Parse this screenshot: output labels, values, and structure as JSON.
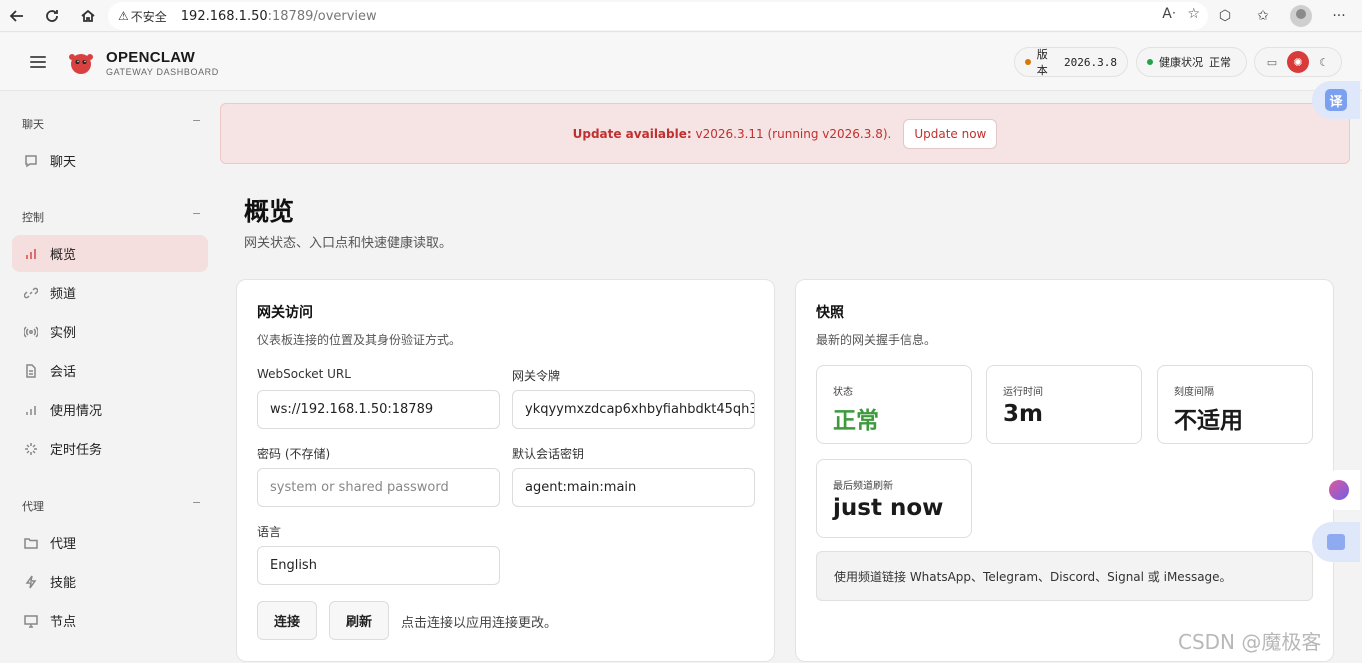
{
  "browser": {
    "insecure_label": "不安全",
    "url_host": "192.168.1.50",
    "url_path": ":18789/overview"
  },
  "header": {
    "brand_title": "OPENCLAW",
    "brand_subtitle": "GATEWAY DASHBOARD",
    "version_label": "版本",
    "version_value": "2026.3.8",
    "health_label": "健康状况",
    "health_value": "正常",
    "version_dot_color": "#d97706",
    "health_dot_color": "#22a34a"
  },
  "sidebar": {
    "sections": [
      {
        "label": "聊天",
        "collapse": "−",
        "items": [
          {
            "label": "聊天",
            "icon": "chat-icon"
          }
        ]
      },
      {
        "label": "控制",
        "collapse": "−",
        "items": [
          {
            "label": "概览",
            "icon": "bar-chart-icon",
            "active": true
          },
          {
            "label": "频道",
            "icon": "link-icon"
          },
          {
            "label": "实例",
            "icon": "broadcast-icon"
          },
          {
            "label": "会话",
            "icon": "document-icon"
          },
          {
            "label": "使用情况",
            "icon": "usage-icon"
          },
          {
            "label": "定时任务",
            "icon": "loader-icon"
          }
        ]
      },
      {
        "label": "代理",
        "collapse": "−",
        "items": [
          {
            "label": "代理",
            "icon": "folder-icon"
          },
          {
            "label": "技能",
            "icon": "bolt-icon"
          },
          {
            "label": "节点",
            "icon": "monitor-icon"
          }
        ]
      }
    ]
  },
  "banner": {
    "bold": "Update available:",
    "text": "v2026.3.11 (running v2026.3.8).",
    "button": "Update now"
  },
  "page": {
    "title": "概览",
    "subtitle": "网关状态、入口点和快速健康读取。"
  },
  "gateway_card": {
    "title": "网关访问",
    "desc": "仪表板连接的位置及其身份验证方式。",
    "ws_label": "WebSocket URL",
    "ws_value": "ws://192.168.1.50:18789",
    "token_label": "网关令牌",
    "token_value": "ykqyymxzdcap6xhbyfiahbdkt45qh3",
    "password_label": "密码 (不存储)",
    "password_placeholder": "system or shared password",
    "session_label": "默认会话密钥",
    "session_value": "agent:main:main",
    "language_label": "语言",
    "language_value": "English",
    "connect_button": "连接",
    "refresh_button": "刷新",
    "hint": "点击连接以应用连接更改。"
  },
  "snapshot_card": {
    "title": "快照",
    "desc": "最新的网关握手信息。",
    "stats": [
      {
        "label": "状态",
        "value": "正常"
      },
      {
        "label": "运行时间",
        "value": "3m"
      },
      {
        "label": "刻度间隔",
        "value": "不适用"
      },
      {
        "label": "最后频道刷新",
        "value": "just now"
      }
    ],
    "notice": "使用频道链接 WhatsApp、Telegram、Discord、Signal 或 iMessage。"
  },
  "floating": {
    "translate": "译"
  },
  "watermark": "CSDN @魔极客"
}
